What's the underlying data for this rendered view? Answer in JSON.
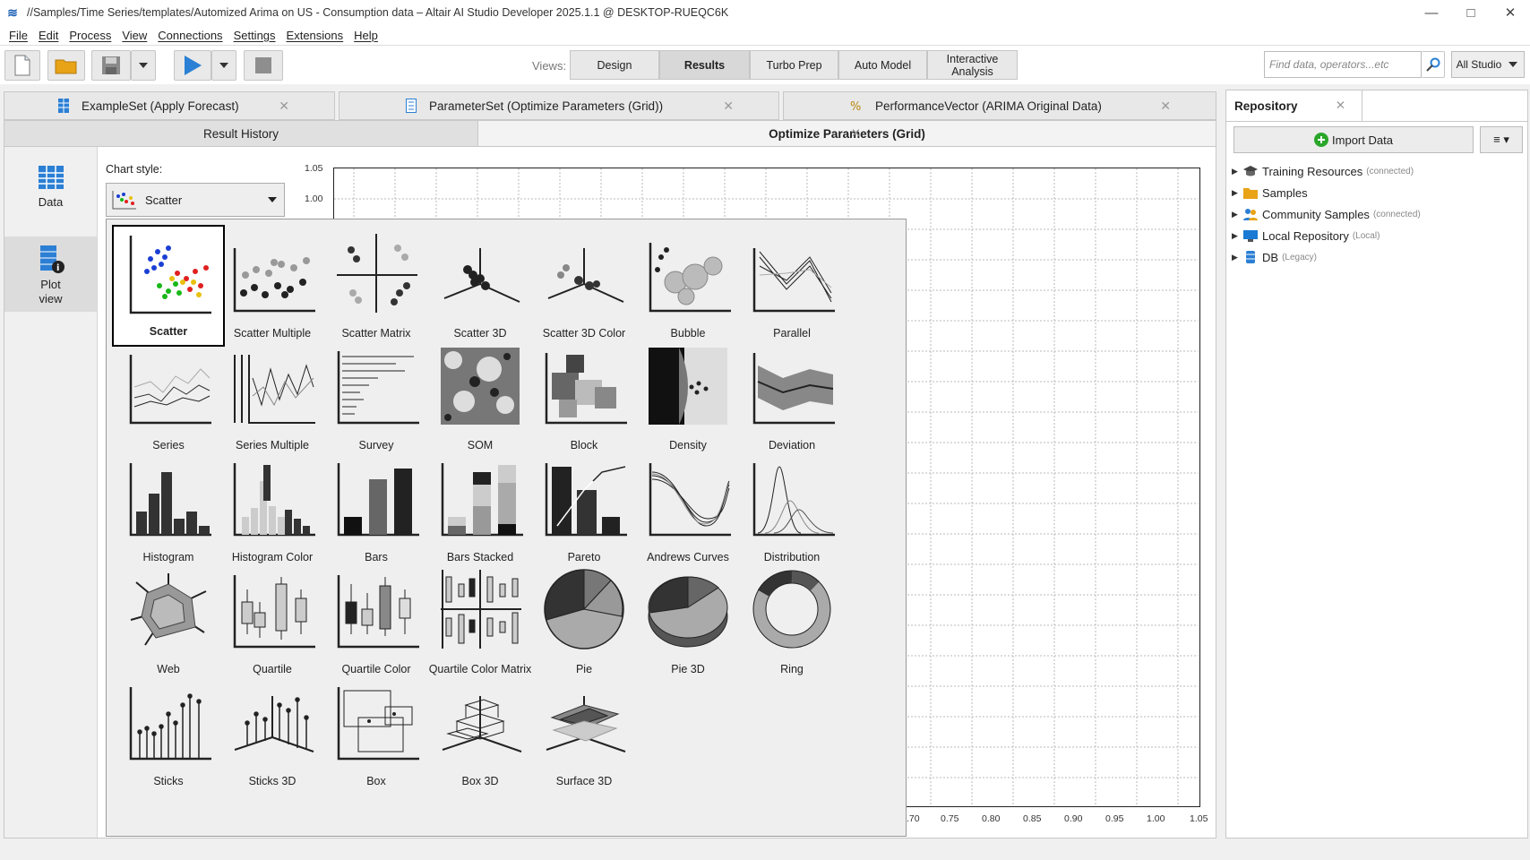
{
  "window": {
    "title": "//Samples/Time Series/templates/Automized Arima on US - Consumption data – Altair AI Studio Developer 2025.1.1 @ DESKTOP-RUEQC6K",
    "minimize": "—",
    "maximize": "□",
    "close": "✕"
  },
  "menu": [
    "File",
    "Edit",
    "Process",
    "View",
    "Connections",
    "Settings",
    "Extensions",
    "Help"
  ],
  "toolbar": {
    "views_label": "Views:",
    "views": [
      "Design",
      "Results",
      "Turbo Prep",
      "Auto Model",
      "Interactive Analysis"
    ],
    "active_view": "Results",
    "search_placeholder": "Find data, operators...etc",
    "all_studio": "All Studio"
  },
  "doc_tabs": [
    {
      "label": "ExampleSet (Apply Forecast)",
      "icon": "table-icon"
    },
    {
      "label": "ParameterSet (Optimize Parameters (Grid))",
      "icon": "parameterset-icon"
    },
    {
      "label": "PerformanceVector (ARIMA Original Data)",
      "icon": "performance-icon"
    }
  ],
  "sub_tabs": [
    "Result History",
    "Optimize Parameters (Grid)"
  ],
  "left_nav": [
    {
      "label": "Data",
      "icon": "data-table-icon"
    },
    {
      "label": "Plot view",
      "icon": "plot-view-icon"
    }
  ],
  "chart_style": {
    "label": "Chart style:",
    "selected": "Scatter"
  },
  "plot": {
    "y_ticks": [
      "1.05",
      "1.00"
    ],
    "x_ticks": [
      ".70",
      "0.75",
      "0.80",
      "0.85",
      "0.90",
      "0.95",
      "1.00",
      "1.05"
    ]
  },
  "gallery": [
    "Scatter",
    "Scatter Multiple",
    "Scatter Matrix",
    "Scatter 3D",
    "Scatter 3D Color",
    "Bubble",
    "Parallel",
    "Series",
    "Series Multiple",
    "Survey",
    "SOM",
    "Block",
    "Density",
    "Deviation",
    "Histogram",
    "Histogram Color",
    "Bars",
    "Bars Stacked",
    "Pareto",
    "Andrews Curves",
    "Distribution",
    "Web",
    "Quartile",
    "Quartile Color",
    "Quartile Color Matrix",
    "Pie",
    "Pie 3D",
    "Ring",
    "Sticks",
    "Sticks 3D",
    "Box",
    "Box 3D",
    "Surface 3D"
  ],
  "gallery_selected": "Scatter",
  "repository": {
    "tab": "Repository",
    "import_button": "Import Data",
    "menu_button": "≡ ▾",
    "items": [
      {
        "label": "Training Resources",
        "note": "(connected)",
        "icon": "training-resources-icon"
      },
      {
        "label": "Samples",
        "note": "",
        "icon": "folder-icon"
      },
      {
        "label": "Community Samples",
        "note": "(connected)",
        "icon": "community-icon"
      },
      {
        "label": "Local Repository",
        "note": "(Local)",
        "icon": "local-repository-icon"
      },
      {
        "label": "DB",
        "note": "(Legacy)",
        "icon": "database-icon"
      }
    ]
  }
}
